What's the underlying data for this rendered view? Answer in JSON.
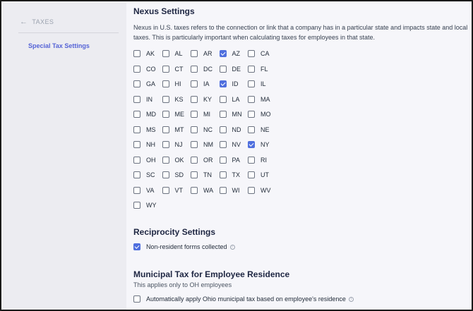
{
  "sidebar": {
    "back_label": "TAXES",
    "items": [
      {
        "label": "Special Tax Settings"
      }
    ]
  },
  "nexus": {
    "title": "Nexus Settings",
    "description": "Nexus in U.S. taxes refers to the connection or link that a company has in a particular state and impacts state and local taxes. This is particularly important when calculating taxes for employees in that state.",
    "states": [
      {
        "code": "AK",
        "checked": false
      },
      {
        "code": "AL",
        "checked": false
      },
      {
        "code": "AR",
        "checked": false
      },
      {
        "code": "AZ",
        "checked": true
      },
      {
        "code": "CA",
        "checked": false
      },
      {
        "code": "CO",
        "checked": false
      },
      {
        "code": "CT",
        "checked": false
      },
      {
        "code": "DC",
        "checked": false
      },
      {
        "code": "DE",
        "checked": false
      },
      {
        "code": "FL",
        "checked": false
      },
      {
        "code": "GA",
        "checked": false
      },
      {
        "code": "HI",
        "checked": false
      },
      {
        "code": "IA",
        "checked": false
      },
      {
        "code": "ID",
        "checked": true
      },
      {
        "code": "IL",
        "checked": false
      },
      {
        "code": "IN",
        "checked": false
      },
      {
        "code": "KS",
        "checked": false
      },
      {
        "code": "KY",
        "checked": false
      },
      {
        "code": "LA",
        "checked": false
      },
      {
        "code": "MA",
        "checked": false
      },
      {
        "code": "MD",
        "checked": false
      },
      {
        "code": "ME",
        "checked": false
      },
      {
        "code": "MI",
        "checked": false
      },
      {
        "code": "MN",
        "checked": false
      },
      {
        "code": "MO",
        "checked": false
      },
      {
        "code": "MS",
        "checked": false
      },
      {
        "code": "MT",
        "checked": false
      },
      {
        "code": "NC",
        "checked": false
      },
      {
        "code": "ND",
        "checked": false
      },
      {
        "code": "NE",
        "checked": false
      },
      {
        "code": "NH",
        "checked": false
      },
      {
        "code": "NJ",
        "checked": false
      },
      {
        "code": "NM",
        "checked": false
      },
      {
        "code": "NV",
        "checked": false
      },
      {
        "code": "NY",
        "checked": true
      },
      {
        "code": "OH",
        "checked": false
      },
      {
        "code": "OK",
        "checked": false
      },
      {
        "code": "OR",
        "checked": false
      },
      {
        "code": "PA",
        "checked": false
      },
      {
        "code": "RI",
        "checked": false
      },
      {
        "code": "SC",
        "checked": false
      },
      {
        "code": "SD",
        "checked": false
      },
      {
        "code": "TN",
        "checked": false
      },
      {
        "code": "TX",
        "checked": false
      },
      {
        "code": "UT",
        "checked": false
      },
      {
        "code": "VA",
        "checked": false
      },
      {
        "code": "VT",
        "checked": false
      },
      {
        "code": "WA",
        "checked": false
      },
      {
        "code": "WI",
        "checked": false
      },
      {
        "code": "WV",
        "checked": false
      },
      {
        "code": "WY",
        "checked": false
      }
    ]
  },
  "reciprocity": {
    "title": "Reciprocity Settings",
    "option_label": "Non-resident forms collected",
    "option_checked": true
  },
  "municipal": {
    "title": "Municipal Tax for Employee Residence",
    "subtitle": "This applies only to OH employees",
    "option_label": "Automatically apply Ohio municipal tax based on employee's residence",
    "option_checked": false
  },
  "colors": {
    "accent": "#4f6fde",
    "sidebar_link": "#5563d6"
  },
  "icons": {
    "back": "arrow-left-icon",
    "info": "info-circle-icon",
    "check": "check-icon"
  }
}
